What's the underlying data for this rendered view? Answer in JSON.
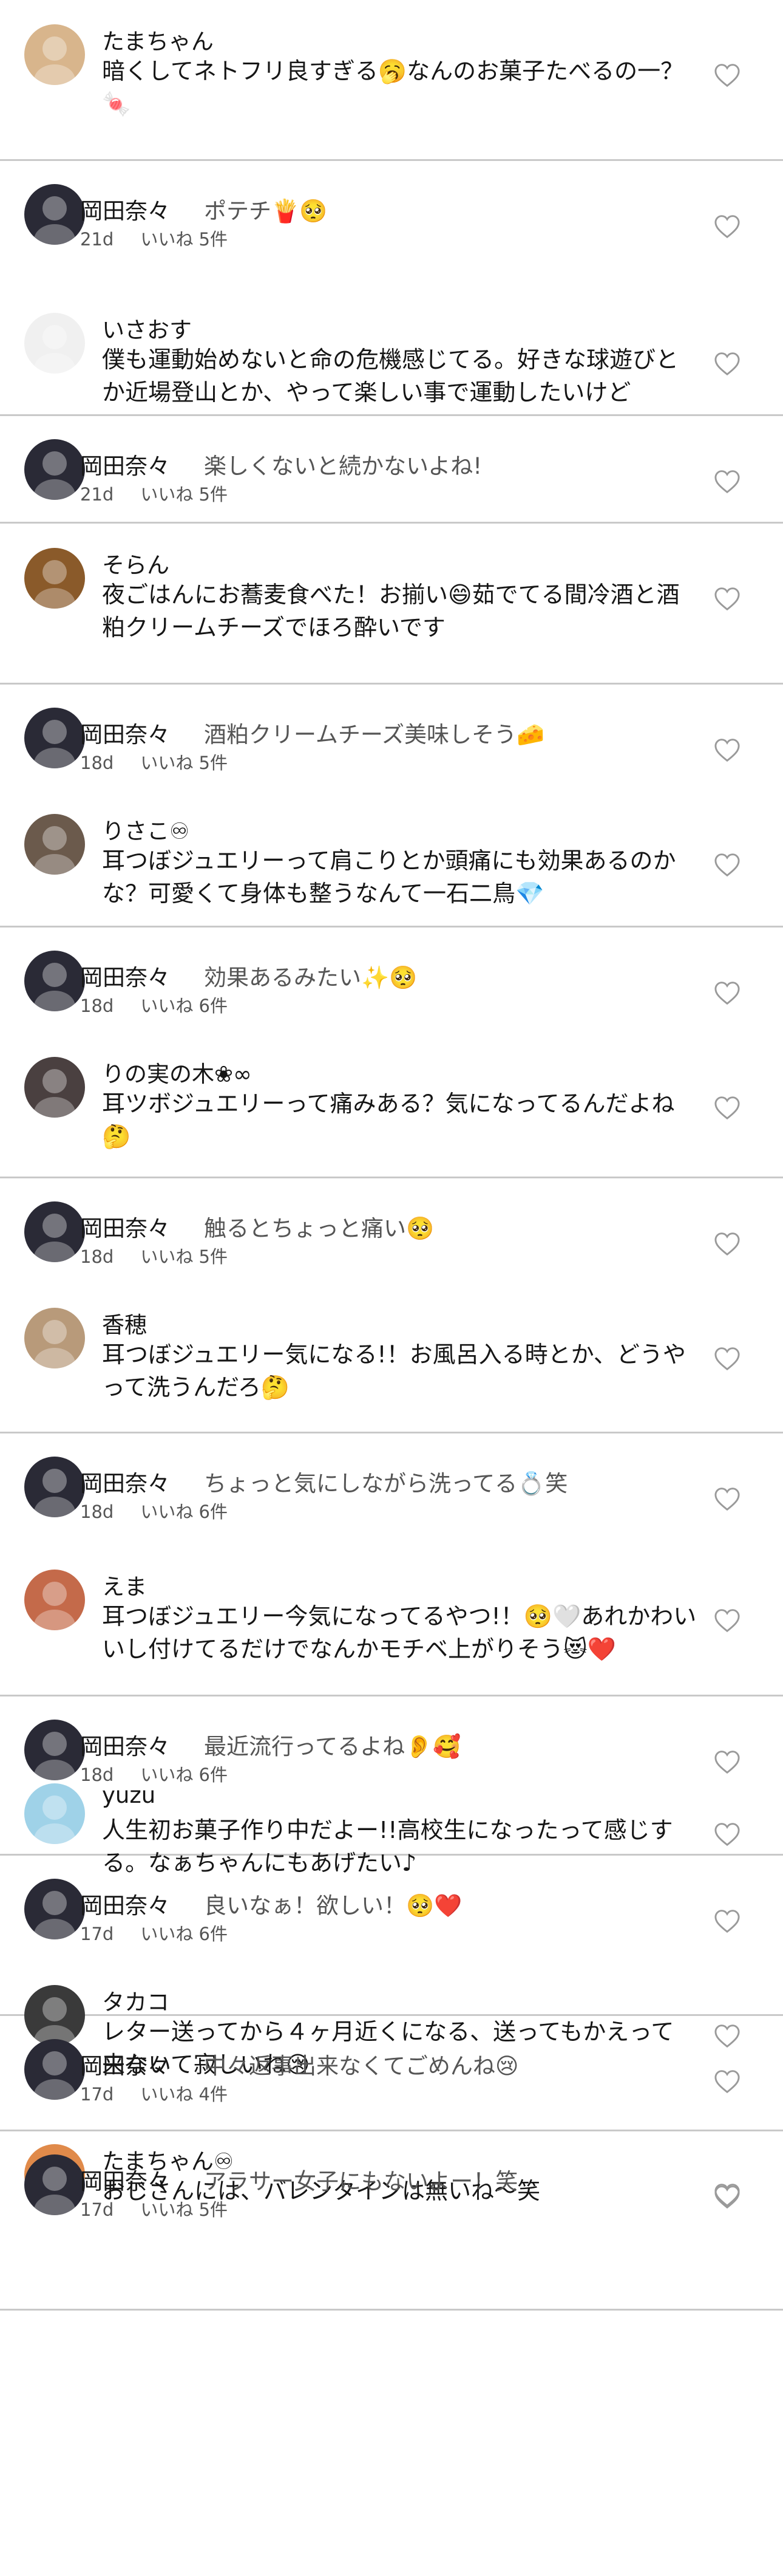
{
  "threads": [
    {
      "comments": [
        {
          "author": "たまちゃん",
          "text": "暗くしてネトフリ良すぎる🥱なんのお菓子たべるの一？🍬",
          "avatar": "#d8b58c"
        }
      ]
    },
    {
      "comments": [
        {
          "author": "岡田奈々",
          "inline": "ポテチ🍟🥺",
          "time": "21d",
          "likes": "いいね 5件",
          "avatar": "#2a2a36"
        },
        {
          "author": "いさおす",
          "text": "僕も運動始めないと命の危機感じてる。好きな球遊びとか近場登山とか、やって楽しい事で運動したいけど",
          "avatar": "#f0f0f0"
        }
      ]
    },
    {
      "comments": [
        {
          "author": "岡田奈々",
          "inline": "楽しくないと続かないよね!",
          "time": "21d",
          "likes": "いいね 5件",
          "avatar": "#2a2a36"
        }
      ]
    },
    {
      "comments": [
        {
          "author": "そらん",
          "text": "夜ごはんにお蕎麦食べた！お揃い😄茹でてる間冷酒と酒粕クリームチーズでほろ酔いです",
          "avatar": "#8a5a2a"
        }
      ]
    },
    {
      "comments": [
        {
          "author": "岡田奈々",
          "inline": "酒粕クリームチーズ美味しそう🧀",
          "time": "18d",
          "likes": "いいね 5件",
          "avatar": "#2a2a36"
        },
        {
          "author": "りさこ♾",
          "text": "耳つぼジュエリーって肩こりとか頭痛にも効果あるのかな？可愛くて身体も整うなんて一石二鳥💎",
          "avatar": "#6b5a4c"
        }
      ]
    },
    {
      "comments": [
        {
          "author": "岡田奈々",
          "inline": "効果あるみたい✨🥺",
          "time": "18d",
          "likes": "いいね 6件",
          "avatar": "#2a2a36"
        },
        {
          "author": "りの実の木❀∞",
          "text": "耳ツボジュエリーって痛みある？気になってるんだよね🤔",
          "avatar": "#4a4040"
        }
      ]
    },
    {
      "comments": [
        {
          "author": "岡田奈々",
          "inline": "触るとちょっと痛い🥺",
          "time": "18d",
          "likes": "いいね 5件",
          "avatar": "#2a2a36"
        },
        {
          "author": "香穂",
          "text": "耳つぼジュエリー気になる!！お風呂入る時とか、どうやって洗うんだろ🤔",
          "avatar": "#b89a7a"
        }
      ]
    },
    {
      "comments": [
        {
          "author": "岡田奈々",
          "inline": "ちょっと気にしながら洗ってる💍笑",
          "time": "18d",
          "likes": "いいね 6件",
          "avatar": "#2a2a36"
        },
        {
          "author": "えま",
          "text": "耳つぼジュエリー今気になってるやつ!！🥺🤍あれかわいいし付けてるだけでなんかモチベ上がりそう😻❤️",
          "avatar": "#c46a4a"
        }
      ]
    },
    {
      "comments": [
        {
          "author": "岡田奈々",
          "inline": "最近流行ってるよね👂🥰",
          "time": "18d",
          "likes": "いいね 6件",
          "avatar": "#2a2a36"
        },
        {
          "author": "yuzu",
          "text": "人生初お菓子作り中だよー!!高校生になったって感じする。なぁちゃんにもあげたい♪",
          "avatar": "#9fd2e8"
        }
      ]
    },
    {
      "comments": [
        {
          "author": "岡田奈々",
          "inline": "良いなぁ！欲しい！🥺❤️",
          "time": "17d",
          "likes": "いいね 6件",
          "avatar": "#2a2a36"
        },
        {
          "author": "タカコ",
          "text": "レター送ってから４ヶ月近くになる、送ってもかえって来ないて寂しいね😢",
          "avatar": "#3a3a3a"
        }
      ]
    },
    {
      "comments": [
        {
          "author": "岡田奈々",
          "inline": "中々返事出来なくてごめんね😢",
          "time": "17d",
          "likes": "いいね 4件",
          "avatar": "#2a2a36"
        },
        {
          "author": "たまちゃん♾",
          "text": "おじさんには、バレンタインは無いね〜笑",
          "avatar": "#e08a4a"
        }
      ]
    },
    {
      "comments": [
        {
          "author": "岡田奈々",
          "inline": "アラサー女子にもないよー！笑",
          "time": "17d",
          "likes": "いいね 5件",
          "avatar": "#2a2a36"
        }
      ]
    }
  ]
}
